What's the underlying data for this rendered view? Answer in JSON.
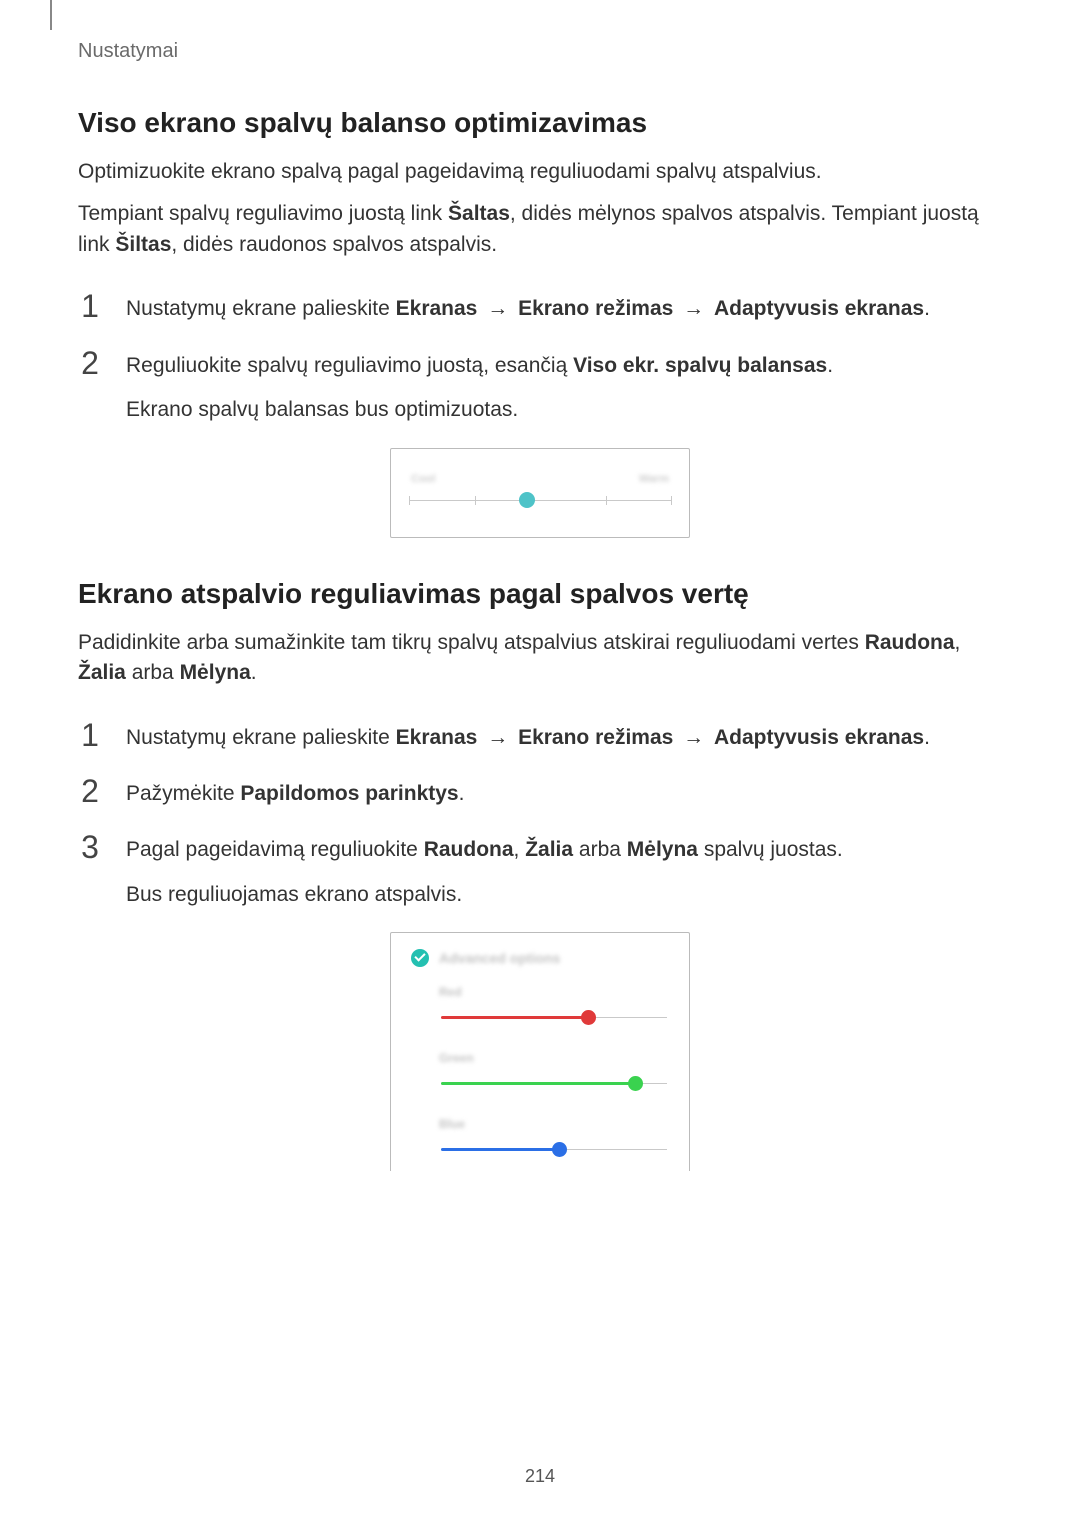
{
  "header": {
    "label": "Nustatymai"
  },
  "section1": {
    "heading": "Viso ekrano spalvų balanso optimizavimas",
    "p1": "Optimizuokite ekrano spalvą pagal pageidavimą reguliuodami spalvų atspalvius.",
    "p2_a": "Tempiant spalvų reguliavimo juostą link ",
    "p2_b": "Šaltas",
    "p2_c": ", didės mėlynos spalvos atspalvis. Tempiant juostą link ",
    "p2_d": "Šiltas",
    "p2_e": ", didės raudonos spalvos atspalvis.",
    "step1_a": "Nustatymų ekrane palieskite ",
    "step1_b": "Ekranas",
    "step1_c": "Ekrano režimas",
    "step1_d": "Adaptyvusis ekranas",
    "step1_e": ".",
    "step2_a": "Reguliuokite spalvų reguliavimo juostą, esančią ",
    "step2_b": "Viso ekr. spalvų balansas",
    "step2_c": ".",
    "step2_sub": "Ekrano spalvų balansas bus optimizuotas."
  },
  "slider1": {
    "left": "Cool",
    "right": "Warm",
    "thumb_percent": 45
  },
  "section2": {
    "heading": "Ekrano atspalvio reguliavimas pagal spalvos vertę",
    "p1_a": "Padidinkite arba sumažinkite tam tikrų spalvų atspalvius atskirai reguliuodami vertes ",
    "p1_b": "Raudona",
    "p1_c": ", ",
    "p1_d": "Žalia",
    "p1_e": " arba ",
    "p1_f": "Mėlyna",
    "p1_g": ".",
    "step1_a": "Nustatymų ekrane palieskite ",
    "step1_b": "Ekranas",
    "step1_c": "Ekrano režimas",
    "step1_d": "Adaptyvusis ekranas",
    "step1_e": ".",
    "step2_a": "Pažymėkite ",
    "step2_b": "Papildomos parinktys",
    "step2_c": ".",
    "step3_a": "Pagal pageidavimą reguliuokite ",
    "step3_b": "Raudona",
    "step3_c": ", ",
    "step3_d": "Žalia",
    "step3_e": " arba ",
    "step3_f": "Mėlyna",
    "step3_g": " spalvų juostas.",
    "step3_sub": "Bus reguliuojamas ekrano atspalvis."
  },
  "advanced": {
    "title": "Advanced options",
    "red_label": "Red",
    "green_label": "Green",
    "blue_label": "Blue",
    "red_percent": 65,
    "green_percent": 86,
    "blue_percent": 52,
    "red_color": "#e03a3a",
    "green_color": "#3ad24f",
    "blue_color": "#2b6fe6"
  },
  "nums": {
    "n1": "1",
    "n2": "2",
    "n3": "3"
  },
  "arrow": "→",
  "page_number": "214"
}
